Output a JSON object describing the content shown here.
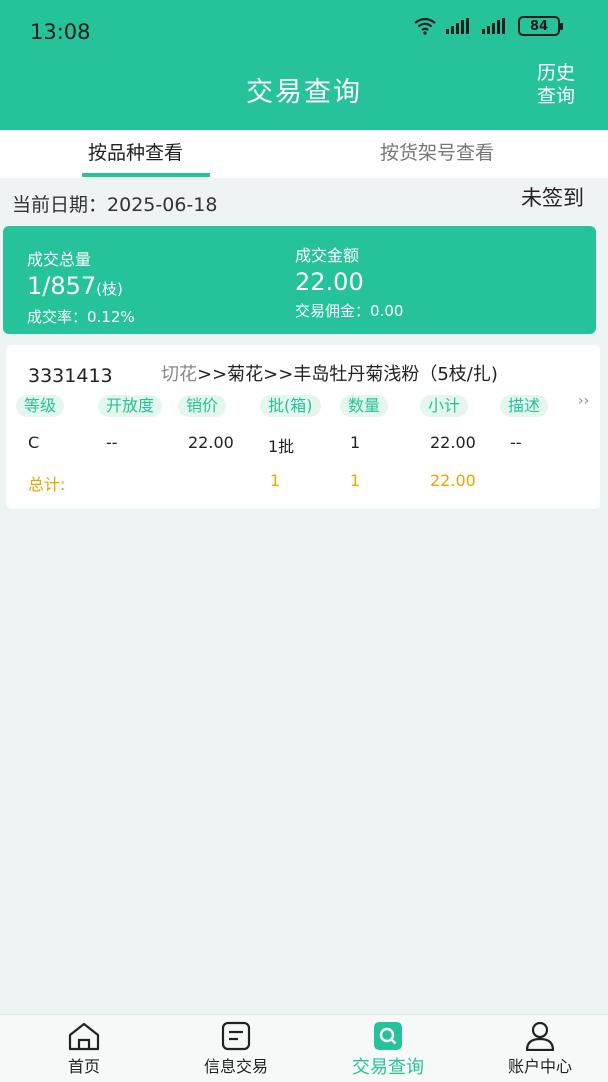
{
  "status_bar": {
    "time": "13:08",
    "battery": "84"
  },
  "header": {
    "title": "交易查询",
    "history_line1": "历史",
    "history_line2": "查询"
  },
  "tabs": [
    {
      "label": "按品种查看"
    },
    {
      "label": "按货架号查看"
    }
  ],
  "date_row": {
    "label": "当前日期：",
    "value": "2025-06-18"
  },
  "sign_status": "未签到",
  "summary": {
    "total_qty_label": "成交总量",
    "total_qty_value": "1/857",
    "total_qty_unit": "(枝)",
    "rate_label": "成交率：",
    "rate_value": "0.12%",
    "amount_label": "成交金额",
    "amount_value": "22.00",
    "commission_label": "交易佣金：",
    "commission_value": "0.00"
  },
  "record": {
    "code": "3331413",
    "category": "切花",
    "path": ">>菊花>>丰岛牡丹菊浅粉（5枝/扎)",
    "columns": [
      "等级",
      "开放度",
      "销价",
      "批(箱)",
      "数量",
      "小计",
      "描述"
    ],
    "more": "››",
    "row": {
      "grade": "C",
      "openness": "--",
      "price": "22.00",
      "batch": "1批",
      "qty": "1",
      "subtotal": "22.00",
      "desc": "--"
    },
    "total": {
      "label": "总计:",
      "batch": "1",
      "qty": "1",
      "subtotal": "22.00"
    }
  },
  "nav": [
    {
      "label": "首页",
      "icon": "home-icon"
    },
    {
      "label": "信息交易",
      "icon": "document-icon"
    },
    {
      "label": "交易查询",
      "icon": "search-doc-icon"
    },
    {
      "label": "账户中心",
      "icon": "user-icon"
    }
  ],
  "colors": {
    "primary": "#26c39a",
    "total": "#e8a400",
    "background": "#eef3f3"
  }
}
